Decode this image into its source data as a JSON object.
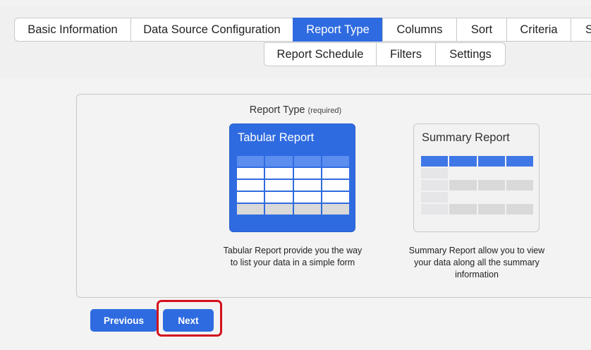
{
  "tabs_row1": [
    "Basic Information",
    "Data Source Configuration",
    "Report Type",
    "Columns",
    "Sort",
    "Criteria",
    "S"
  ],
  "tabs_row2": [
    "Report Schedule",
    "Filters",
    "Settings"
  ],
  "active_tab": "Report Type",
  "report_type": {
    "label": "Report Type",
    "required": "(required)",
    "options": [
      {
        "title": "Tabular Report",
        "description": "Tabular Report provide you the way to list your data in a simple form",
        "selected": true
      },
      {
        "title": "Summary Report",
        "description": "Summary Report allow you to view your data along all the summary information",
        "selected": false
      }
    ]
  },
  "buttons": {
    "previous": "Previous",
    "next": "Next"
  },
  "colors": {
    "accent": "#2f6be0",
    "highlight": "#d4101c"
  }
}
